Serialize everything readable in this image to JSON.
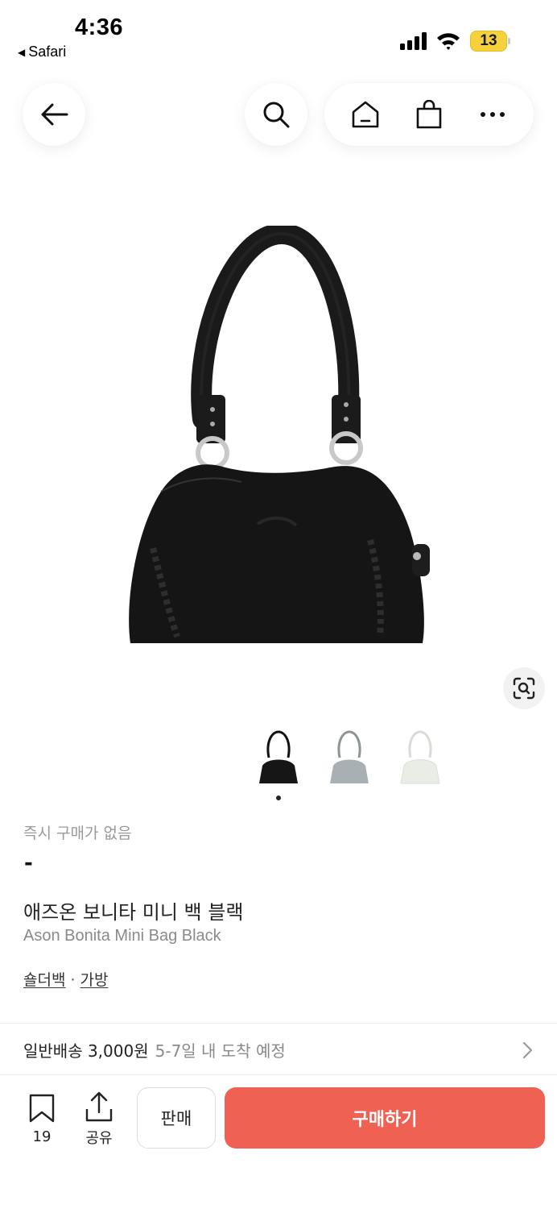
{
  "status_bar": {
    "time": "4:36",
    "back_app": "Safari",
    "battery_level": "13",
    "battery_color": "#f5d23b"
  },
  "nav": {
    "icons": [
      "back-arrow-icon",
      "search-icon",
      "home-icon",
      "shopping-bag-icon",
      "more-icon"
    ]
  },
  "gallery": {
    "thumbnails": [
      "black",
      "silver",
      "white"
    ],
    "active_index": 0
  },
  "product": {
    "instant_price_label": "즉시 구매가 없음",
    "price": "-",
    "name_ko": "애즈온 보니타 미니 백 블랙",
    "name_en": "Ason Bonita Mini Bag Black",
    "category_1": "숄더백",
    "category_separator": "·",
    "category_2": "가방"
  },
  "shipping": {
    "main": "일반배송 3,000원",
    "eta": "5-7일 내 도착 예정"
  },
  "bottom_bar": {
    "bookmark_count": "19",
    "share_label": "공유",
    "sell_label": "판매",
    "buy_label": "구매하기",
    "buy_color": "#ef6253"
  }
}
